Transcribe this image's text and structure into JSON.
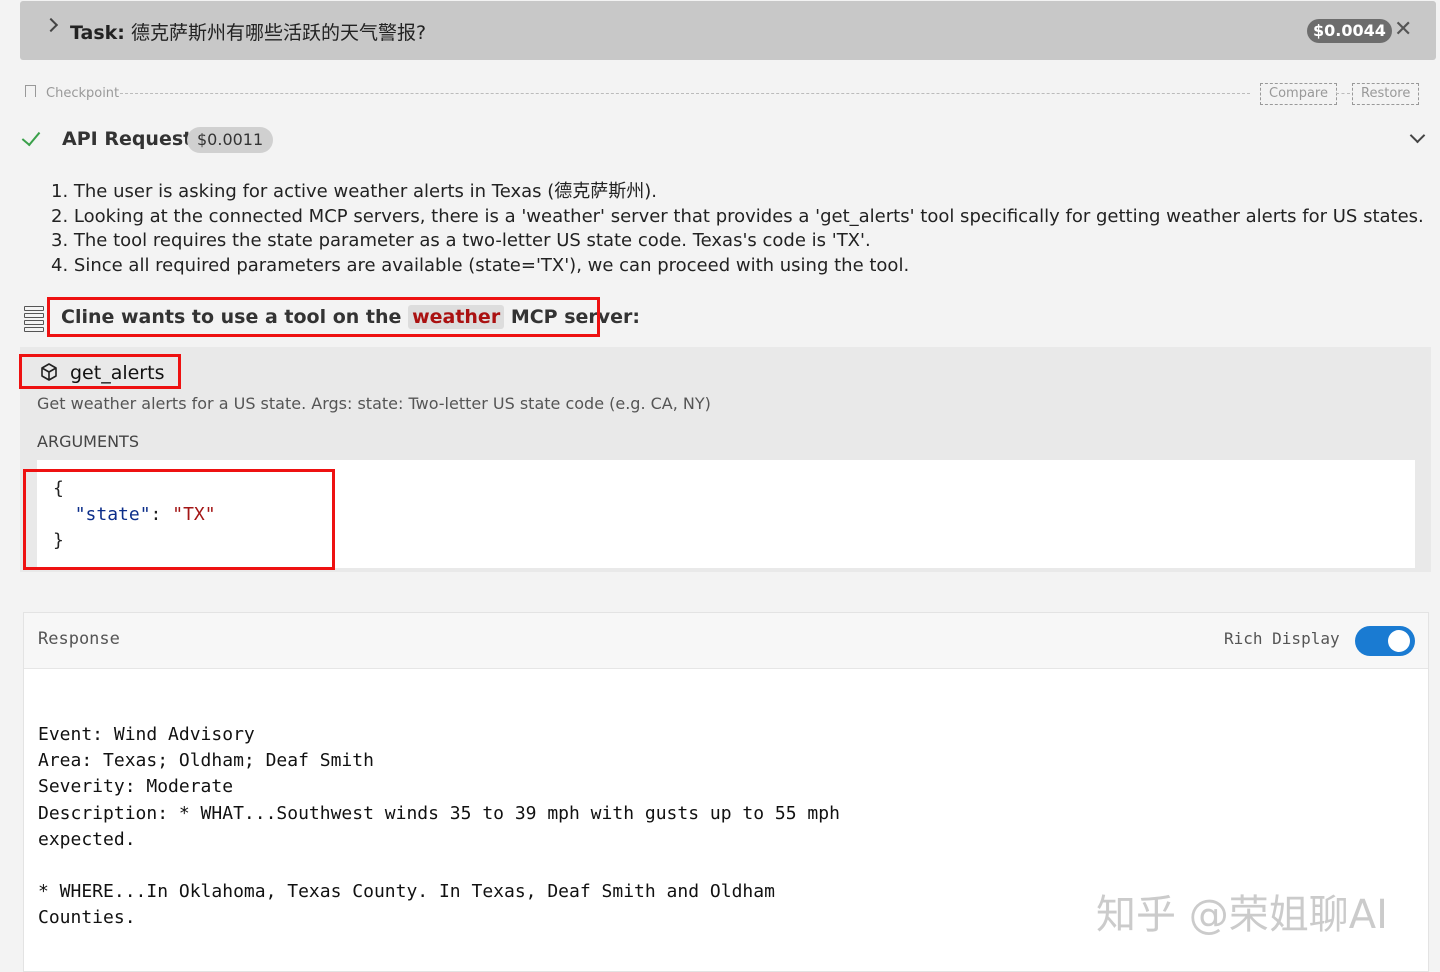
{
  "task": {
    "label": "Task:",
    "text": "德克萨斯州有哪些活跃的天气警报?",
    "cost": "$0.0044"
  },
  "checkpoint": {
    "label": "Checkpoint",
    "compare": "Compare",
    "restore": "Restore"
  },
  "api_request": {
    "title": "API Request",
    "cost": "$0.0011"
  },
  "reasoning": [
    "1. The user is asking for active weather alerts in Texas (德克萨斯州).",
    "2. Looking at the connected MCP servers, there is a 'weather' server that provides a 'get_alerts' tool specifically for getting weather alerts for US states.",
    "3. The tool requires the state parameter as a two-letter US state code. Texas's code is 'TX'.",
    "4. Since all required parameters are available (state='TX'), we can proceed with using the tool."
  ],
  "mcp": {
    "prefix": "Cline wants to use a tool on the",
    "server": "weather",
    "suffix": "MCP server:"
  },
  "tool": {
    "name": "get_alerts",
    "description": "Get weather alerts for a US state. Args: state: Two-letter US state code (e.g. CA, NY)",
    "arguments_label": "ARGUMENTS",
    "arg_key": "\"state\"",
    "arg_value": "\"TX\""
  },
  "response": {
    "label": "Response",
    "rich_display_label": "Rich Display",
    "rich_display_on": true,
    "text": "Event: Wind Advisory\nArea: Texas; Oldham; Deaf Smith\nSeverity: Moderate\nDescription: * WHAT...Southwest winds 35 to 39 mph with gusts up to 55 mph\nexpected.\n\n* WHERE...In Oklahoma, Texas County. In Texas, Deaf Smith and Oldham\nCounties."
  },
  "watermark": "知乎 @荣姐聊AI"
}
